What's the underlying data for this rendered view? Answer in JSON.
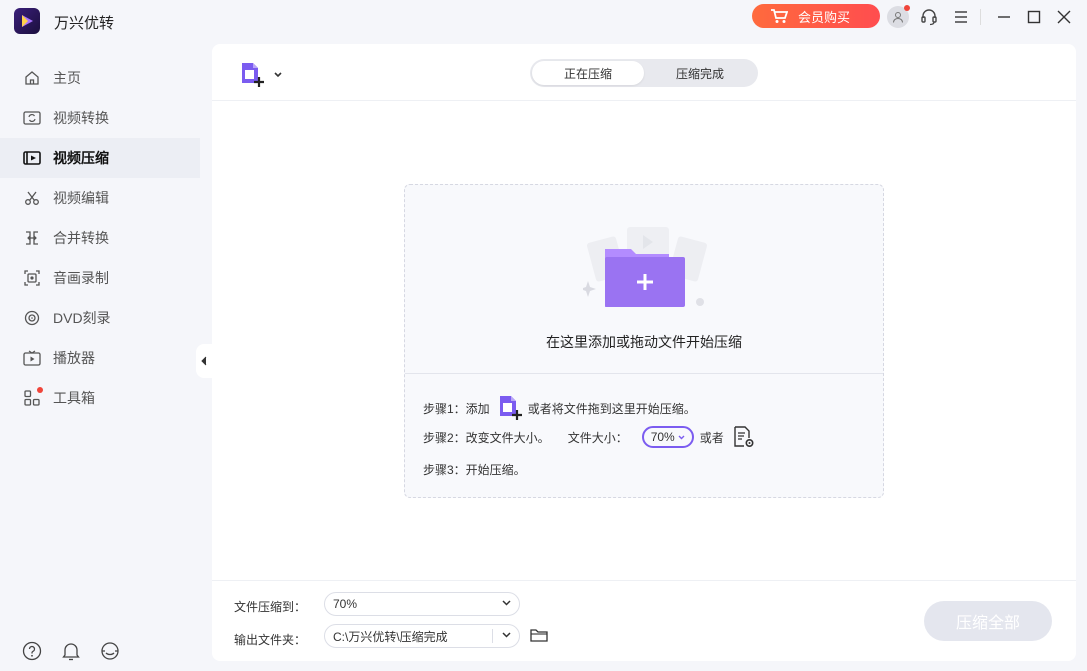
{
  "app": {
    "title": "万兴优转",
    "vip_label": "会员购买"
  },
  "sidebar": {
    "items": [
      {
        "label": "主页",
        "icon": "home-icon"
      },
      {
        "label": "视频转换",
        "icon": "video-convert-icon"
      },
      {
        "label": "视频压缩",
        "icon": "video-compress-icon",
        "active": true
      },
      {
        "label": "视频编辑",
        "icon": "scissors-icon"
      },
      {
        "label": "合并转换",
        "icon": "merge-icon"
      },
      {
        "label": "音画录制",
        "icon": "record-icon"
      },
      {
        "label": "DVD刻录",
        "icon": "disc-icon"
      },
      {
        "label": "播放器",
        "icon": "player-icon"
      },
      {
        "label": "工具箱",
        "icon": "toolbox-icon",
        "badge": true
      }
    ]
  },
  "tabs": {
    "compressing": "正在压缩",
    "finished": "压缩完成"
  },
  "dropzone": {
    "hint": "在这里添加或拖动文件开始压缩",
    "step1_prefix": "步骤1：添加",
    "step1_suffix": "或者将文件拖到这里开始压缩。",
    "step2_prefix": "步骤2：改变文件大小。",
    "step2_size_label": "文件大小：",
    "step2_value": "70%",
    "step2_or": "或者",
    "step3": "步骤3：开始压缩。"
  },
  "footer": {
    "compress_to_label": "文件压缩到：",
    "compress_to_value": "70%",
    "output_label": "输出文件夹：",
    "output_value": "C:\\万兴优转\\压缩完成",
    "compress_all": "压缩全部"
  },
  "colors": {
    "accent": "#7b5cf0",
    "vip_start": "#ff6a3d",
    "vip_end": "#ff4d4f",
    "badge": "#f0453a"
  }
}
